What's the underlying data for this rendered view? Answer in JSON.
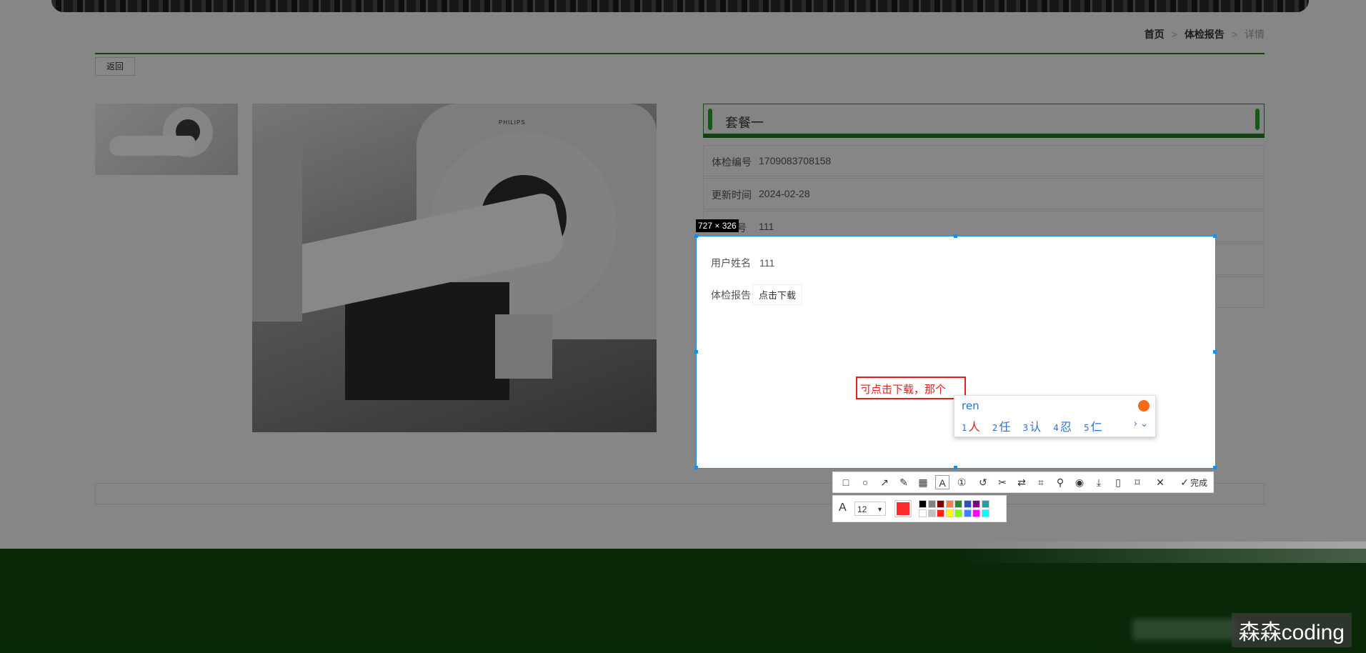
{
  "breadcrumb": {
    "home": "首页",
    "section": "体检报告",
    "current": "详情",
    "sep": ">"
  },
  "back_button": "返回",
  "package_title": "套餐一",
  "info_rows": [
    {
      "label": "体检编号",
      "value": "1709083708158"
    },
    {
      "label": "更新时间",
      "value": "2024-02-28"
    },
    {
      "label": "号",
      "value": "111"
    }
  ],
  "device_brand": "PHILIPS",
  "selection": {
    "size_label": "727 × 326",
    "user_name_label": "用户姓名",
    "user_name_value": "111",
    "report_label": "体检报告",
    "download_button": "点击下载"
  },
  "annotation_text": "可点击下载，那个",
  "ime": {
    "pinyin": "ren",
    "candidates": [
      {
        "num": "1",
        "text": "人"
      },
      {
        "num": "2",
        "text": "任"
      },
      {
        "num": "3",
        "text": "认"
      },
      {
        "num": "4",
        "text": "忍"
      },
      {
        "num": "5",
        "text": "仁"
      }
    ],
    "nav": "› ⌄"
  },
  "toolbar": {
    "icons": [
      "rectangle-icon",
      "ellipse-icon",
      "arrow-icon",
      "pencil-icon",
      "mosaic-icon",
      "text-icon",
      "serial-number-icon",
      "undo-icon",
      "cut-icon",
      "translate-icon",
      "ocr-icon",
      "pin-icon",
      "record-icon",
      "save-icon",
      "long-screenshot-icon",
      "bookmark-icon",
      "close-icon"
    ],
    "done_label": "完成"
  },
  "text_tool": {
    "font_letter": "A",
    "font_size": "12",
    "current_color": "#ff2a2a"
  },
  "palette": [
    "#000000",
    "#808080",
    "#800000",
    "#ff8040",
    "#2e8b2e",
    "#3050c0",
    "#800080",
    "#20a0a0",
    "#ffffff",
    "#c0c0c0",
    "#ff2020",
    "#ffff00",
    "#80ff00",
    "#4080ff",
    "#ff00ff",
    "#00ffff"
  ],
  "watermark": "森森coding",
  "colors": {
    "accent": "#1e7b1e",
    "selection": "#1a8fe0",
    "annotation": "#e02020"
  }
}
